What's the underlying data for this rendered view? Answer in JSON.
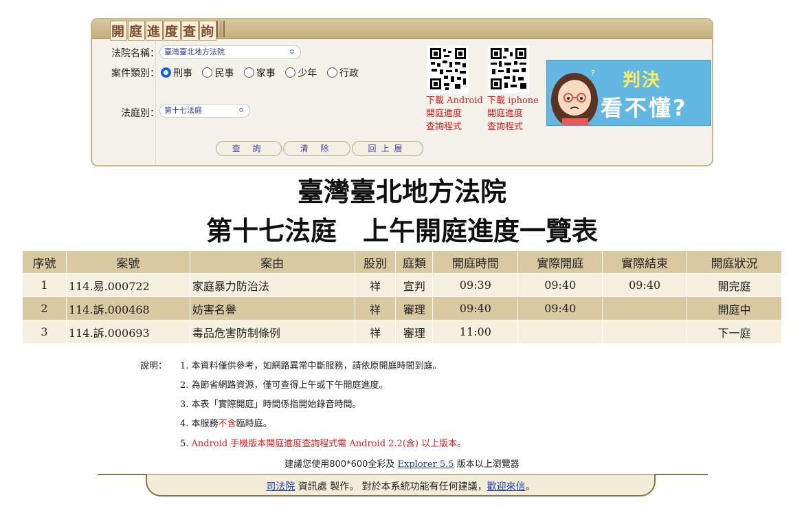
{
  "panel": {
    "title_chars": [
      "開",
      "庭",
      "進",
      "度",
      "查",
      "詢"
    ],
    "court_label": "法院名稱：",
    "court_value": "臺灣臺北地方法院",
    "type_label": "案件類別：",
    "types": [
      {
        "label": "刑事",
        "checked": true
      },
      {
        "label": "民事",
        "checked": false
      },
      {
        "label": "家事",
        "checked": false
      },
      {
        "label": "少年",
        "checked": false
      },
      {
        "label": "行政",
        "checked": false
      }
    ],
    "room_label": "法庭別：",
    "room_value": "第十七法庭",
    "buttons": {
      "query": "查 詢",
      "clear": "清 除",
      "back": "回上層"
    },
    "qr_android": {
      "line1": "下載 Android",
      "line2": "開庭進度",
      "line3": "查詢程式"
    },
    "qr_iphone": {
      "line1": "下載 iphone",
      "line2": "開庭進度",
      "line3": "查詢程式"
    },
    "banner": {
      "line1": "判決",
      "line2": "看不懂?"
    }
  },
  "court_title": "臺灣臺北地方法院",
  "room_title": "第十七法庭　上午開庭進度一覽表",
  "table": {
    "headers": [
      "序號",
      "案號",
      "案由",
      "股別",
      "庭類",
      "開庭時間",
      "實際開庭",
      "實際結束",
      "開庭狀況"
    ],
    "rows": [
      {
        "seq": "1",
        "case": "114.易.000722",
        "reason": "家庭暴力防治法",
        "div": "祥",
        "kind": "宣判",
        "time": "09:39",
        "start": "09:40",
        "end": "09:40",
        "status": "開完庭"
      },
      {
        "seq": "2",
        "case": "114.訴.000468",
        "reason": "妨害名譽",
        "div": "祥",
        "kind": "審理",
        "time": "09:40",
        "start": "09:40",
        "end": "",
        "status": "開庭中"
      },
      {
        "seq": "3",
        "case": "114.訴.000693",
        "reason": "毒品危害防制條例",
        "div": "祥",
        "kind": "審理",
        "time": "11:00",
        "start": "",
        "end": "",
        "status": "下一庭"
      }
    ]
  },
  "notes": {
    "label": "說明：",
    "items": [
      {
        "num": "1.",
        "text": "本資料僅供參考，如網路異常中斷服務，請依原開庭時間到庭。"
      },
      {
        "num": "2.",
        "text": "為節省網路資源，僅可查得上午或下午開庭進度。"
      },
      {
        "num": "3.",
        "text": "本表「實際開庭」時間係指開始錄音時間。"
      },
      {
        "num": "4.",
        "pre": "本服務",
        "red": "不含",
        "post": "臨時庭。"
      },
      {
        "num": "5.",
        "text": "Android 手機版本開庭進度查詢程式需 Android 2.2(含) 以上版本。"
      }
    ],
    "browser_pre": "建議您使用800*600全彩及",
    "browser_link": "Explorer 5.5",
    "browser_post": "版本以上瀏覽器"
  },
  "footer": {
    "link1": "司法院",
    "mid": " 資訊處 製作。 對於本系統功能有任何建議，",
    "link2": "歡迎來信",
    "end": "。"
  }
}
